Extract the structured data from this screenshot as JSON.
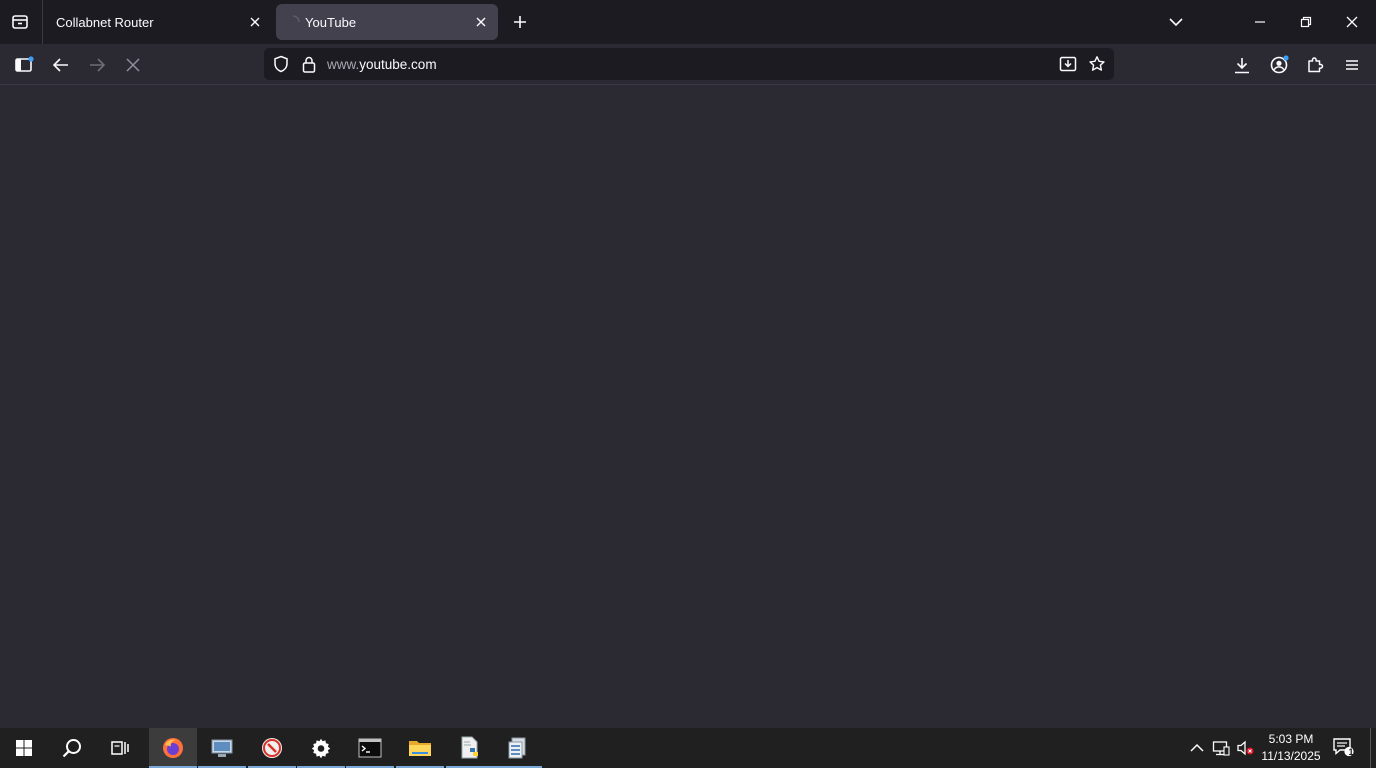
{
  "browser": {
    "tabs": [
      {
        "title": "Collabnet Router",
        "active": false
      },
      {
        "title": "YouTube",
        "active": true
      }
    ],
    "url": {
      "prefix": "www.",
      "domain": "youtube.com"
    }
  },
  "taskbar": {
    "apps": [
      {
        "name": "firefox",
        "active": true
      },
      {
        "name": "remote-desktop",
        "active": false
      },
      {
        "name": "red-app",
        "active": false
      },
      {
        "name": "settings",
        "active": false
      },
      {
        "name": "terminal",
        "active": false
      },
      {
        "name": "file-explorer",
        "active": false
      },
      {
        "name": "python-editor",
        "active": false
      },
      {
        "name": "disk-utility",
        "active": false
      }
    ],
    "clock": {
      "time": "5:03 PM",
      "date": "11/13/2025"
    },
    "notification_count": "1"
  },
  "colors": {
    "tabstrip_bg": "#1c1b22",
    "toolbar_bg": "#2b2a33",
    "active_tab_bg": "#42414d",
    "content_bg": "#2b2a33",
    "taskbar_bg": "#202020",
    "accent_dot": "#3d9ff5"
  }
}
